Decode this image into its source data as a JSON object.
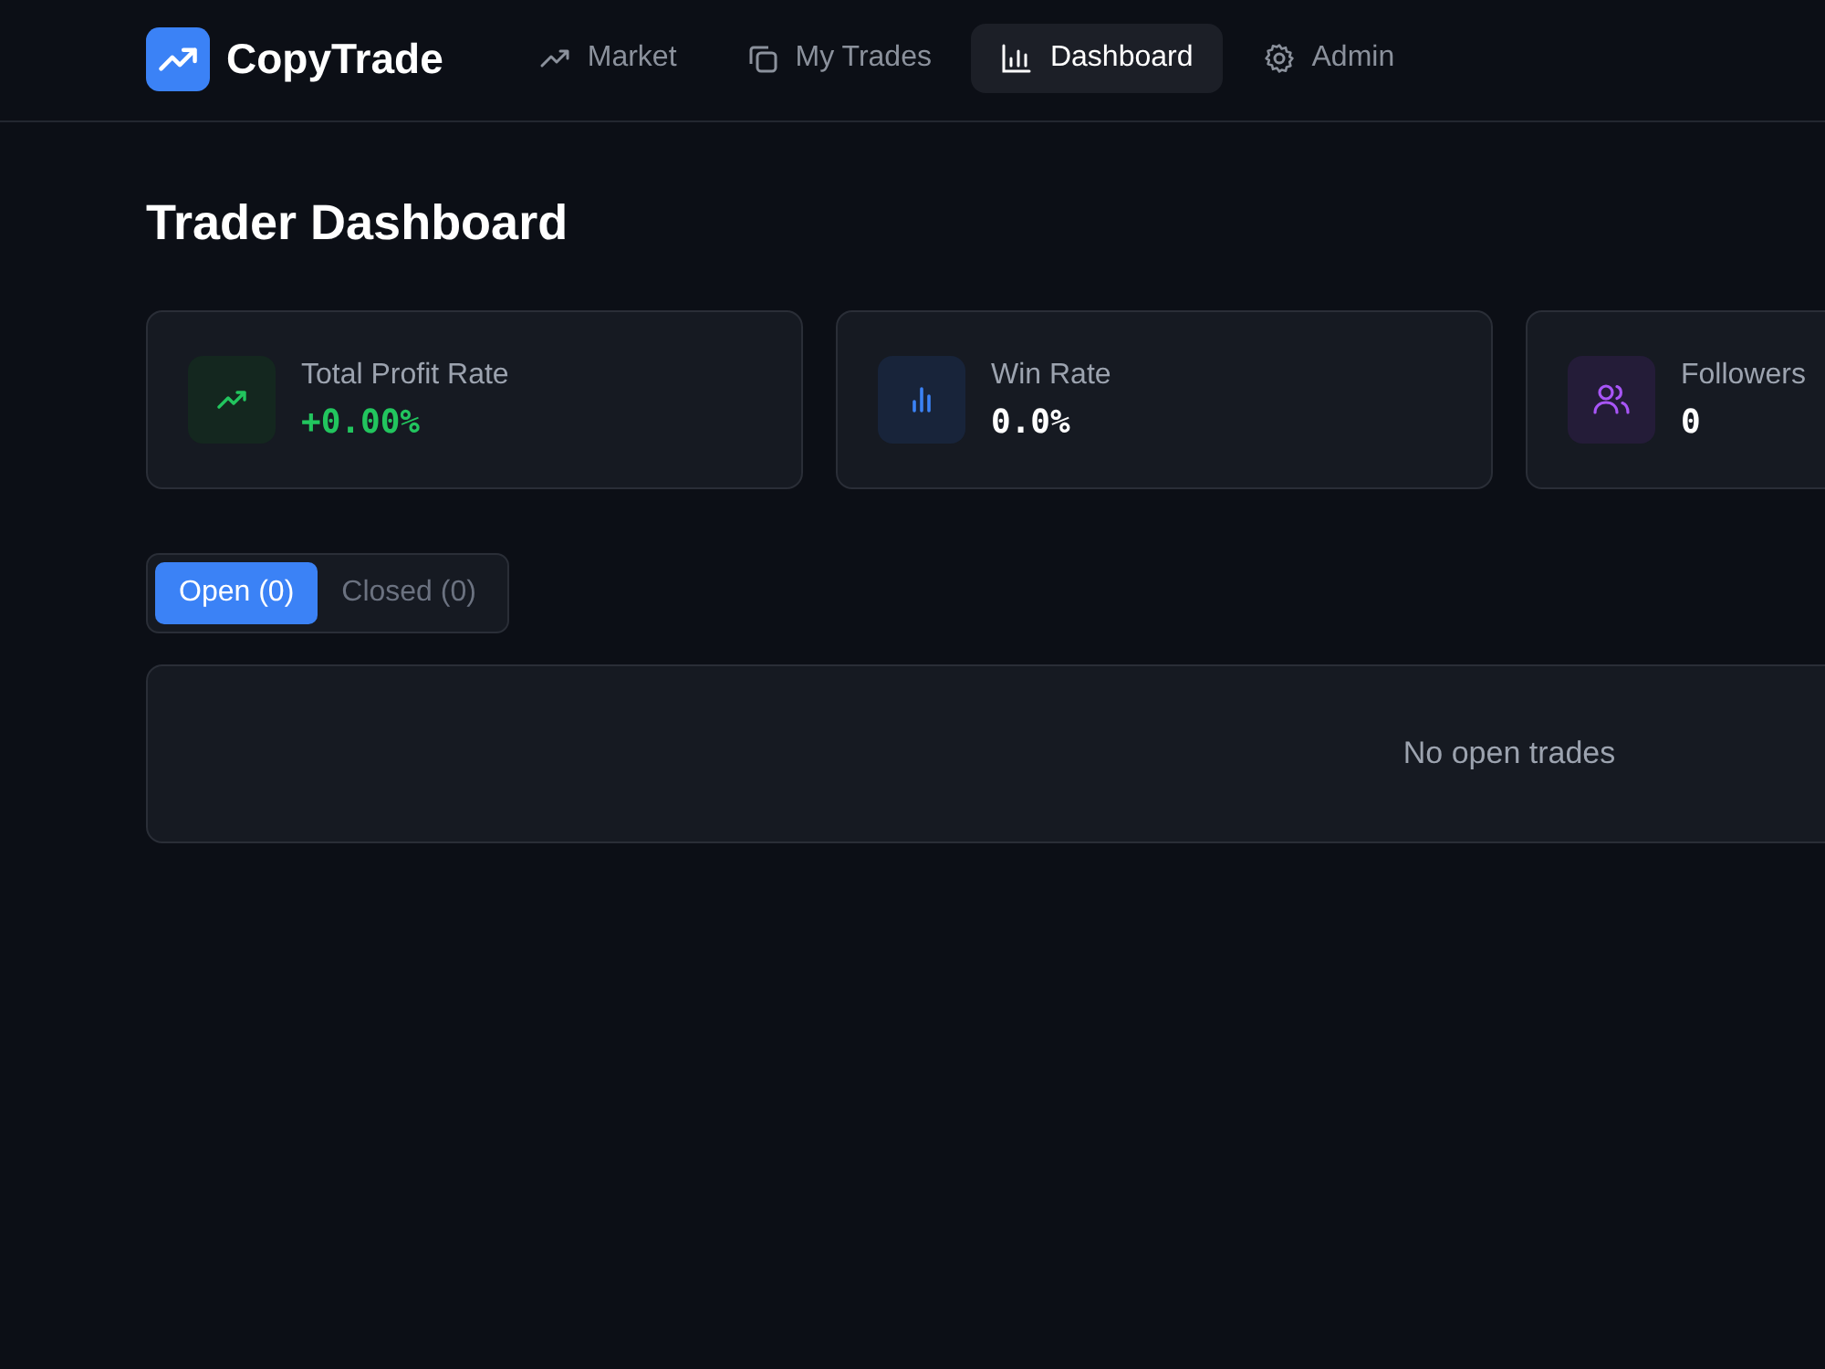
{
  "brand": {
    "name": "CopyTrade"
  },
  "nav": [
    {
      "label": "Market",
      "kind": "trend",
      "selected": false
    },
    {
      "label": "My Trades",
      "kind": "copy",
      "selected": false
    },
    {
      "label": "Dashboard",
      "kind": "bars",
      "selected": true
    },
    {
      "label": "Admin",
      "kind": "gear",
      "selected": false
    }
  ],
  "page_title": "Trader Dashboard",
  "stats": [
    {
      "label": "Total Profit Rate",
      "value": "+0.00%",
      "kind": "profit"
    },
    {
      "label": "Win Rate",
      "value": "0.0%",
      "kind": "winrate"
    },
    {
      "label": "Followers",
      "value": "0",
      "kind": "followers"
    }
  ],
  "tabs": [
    {
      "label": "Open (0)",
      "selected": true
    },
    {
      "label": "Closed (0)",
      "selected": false
    }
  ],
  "empty_message": "No open trades"
}
